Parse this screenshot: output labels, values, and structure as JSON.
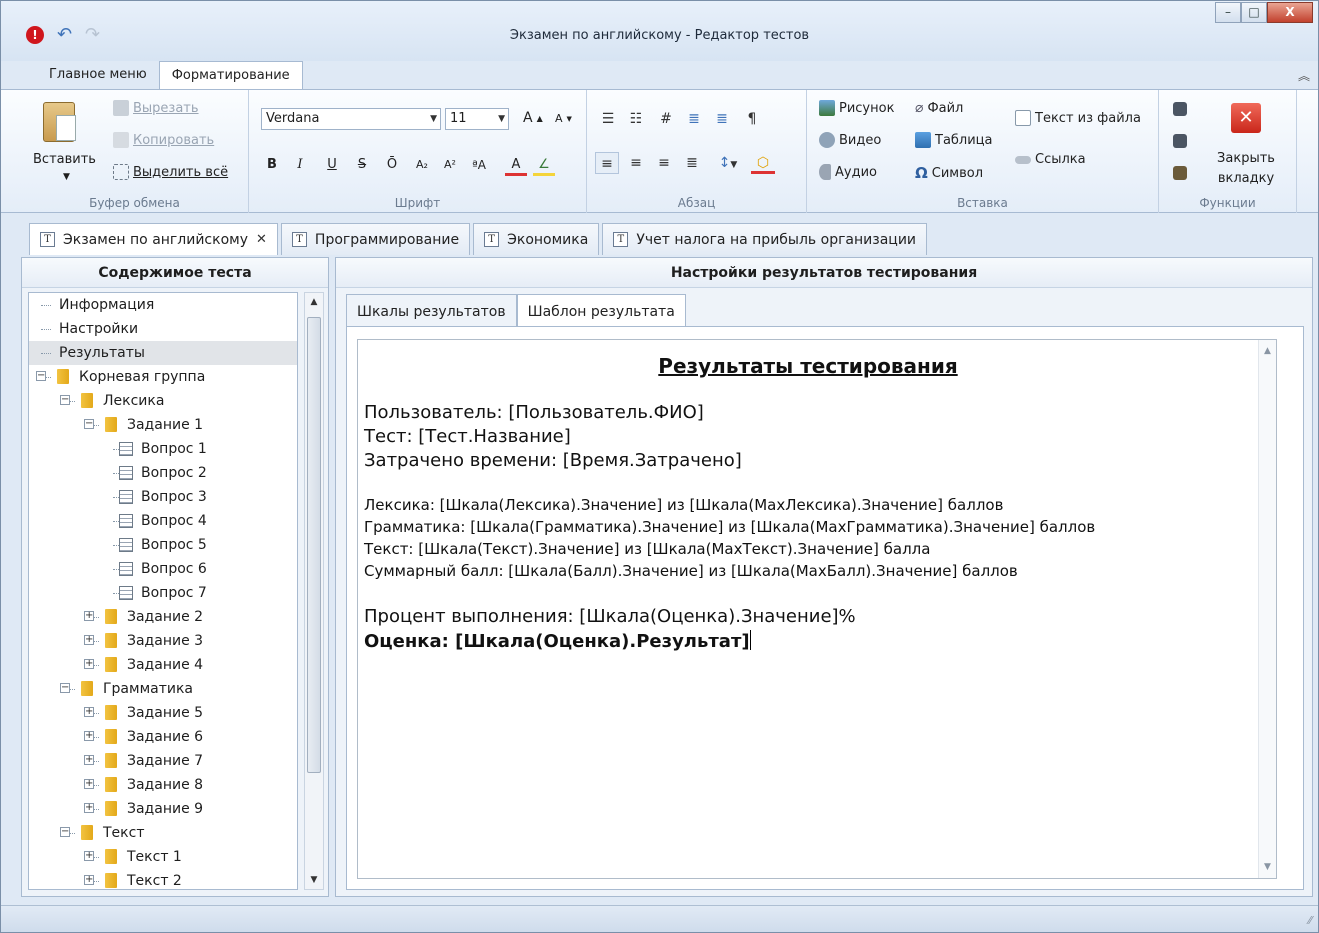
{
  "window": {
    "title": "Экзамен по английскому - Редактор тестов",
    "buttons": {
      "minimize": "–",
      "maximize": "□",
      "close": "X"
    }
  },
  "quick_access": {
    "info": "!",
    "undo": "↶",
    "redo": "↷"
  },
  "ribbon": {
    "tabs": [
      "Главное меню",
      "Форматирование"
    ],
    "active_tab": "Форматирование",
    "clipboard": {
      "label": "Буфер обмена",
      "paste": "Вставить",
      "cut": "Вырезать",
      "copy": "Копировать",
      "select_all": "Выделить всё"
    },
    "font": {
      "label": "Шрифт",
      "family": "Verdana",
      "size": "11",
      "buttons": [
        "B",
        "I",
        "U",
        "S",
        "Ō",
        "A₂",
        "A²",
        "ªA",
        "A",
        "∠"
      ],
      "grow": "A",
      "shrink": "A"
    },
    "paragraph": {
      "label": "Абзац",
      "row1": [
        "☰",
        "☷",
        "#",
        "≣",
        "≣",
        "¶"
      ],
      "row2": [
        "≡",
        "≡",
        "≡",
        "≣",
        "↕",
        "⬡"
      ]
    },
    "insert": {
      "label": "Вставка",
      "picture": "Рисунок",
      "video": "Видео",
      "audio": "Аудио",
      "file": "Файл",
      "table": "Таблица",
      "symbol": "Символ",
      "text_from_file": "Текст из файла",
      "link": "Ссылка"
    },
    "functions": {
      "label": "Функции",
      "close_tab": "Закрыть вкладку",
      "close_tab_line1": "Закрыть",
      "close_tab_line2": "вкладку"
    }
  },
  "doc_tabs": [
    {
      "label": "Экзамен по английскому",
      "active": true,
      "close": "✕"
    },
    {
      "label": "Программирование"
    },
    {
      "label": "Экономика"
    },
    {
      "label": "Учет налога на прибыль организации"
    }
  ],
  "left_panel": {
    "title": "Содержимое теста",
    "tree": [
      {
        "label": "Информация",
        "level": 0,
        "type": "leaf"
      },
      {
        "label": "Настройки",
        "level": 0,
        "type": "leaf"
      },
      {
        "label": "Результаты",
        "level": 0,
        "type": "leaf",
        "selected": true
      },
      {
        "label": "Корневая группа",
        "level": 0,
        "type": "folder",
        "expanded": true
      },
      {
        "label": "Лексика",
        "level": 1,
        "type": "folder",
        "expanded": true
      },
      {
        "label": "Задание 1",
        "level": 2,
        "type": "folder",
        "expanded": true
      },
      {
        "label": "Вопрос 1",
        "level": 3,
        "type": "question"
      },
      {
        "label": "Вопрос 2",
        "level": 3,
        "type": "question"
      },
      {
        "label": "Вопрос 3",
        "level": 3,
        "type": "question"
      },
      {
        "label": "Вопрос 4",
        "level": 3,
        "type": "question"
      },
      {
        "label": "Вопрос 5",
        "level": 3,
        "type": "question"
      },
      {
        "label": "Вопрос 6",
        "level": 3,
        "type": "question"
      },
      {
        "label": "Вопрос 7",
        "level": 3,
        "type": "question"
      },
      {
        "label": "Задание 2",
        "level": 2,
        "type": "folder",
        "expanded": false
      },
      {
        "label": "Задание 3",
        "level": 2,
        "type": "folder",
        "expanded": false
      },
      {
        "label": "Задание 4",
        "level": 2,
        "type": "folder",
        "expanded": false
      },
      {
        "label": "Грамматика",
        "level": 1,
        "type": "folder",
        "expanded": true
      },
      {
        "label": "Задание 5",
        "level": 2,
        "type": "folder",
        "expanded": false
      },
      {
        "label": "Задание 6",
        "level": 2,
        "type": "folder",
        "expanded": false
      },
      {
        "label": "Задание 7",
        "level": 2,
        "type": "folder",
        "expanded": false
      },
      {
        "label": "Задание 8",
        "level": 2,
        "type": "folder",
        "expanded": false
      },
      {
        "label": "Задание 9",
        "level": 2,
        "type": "folder",
        "expanded": false
      },
      {
        "label": "Текст",
        "level": 1,
        "type": "folder",
        "expanded": true
      },
      {
        "label": "Текст 1",
        "level": 2,
        "type": "folder",
        "expanded": false
      },
      {
        "label": "Текст 2",
        "level": 2,
        "type": "folder",
        "expanded": false
      }
    ]
  },
  "right_panel": {
    "title": "Настройки результатов тестирования",
    "tabs": [
      "Шкалы результатов",
      "Шаблон результата"
    ],
    "active_tab": "Шаблон результата",
    "editor": {
      "heading": "Результаты тестирования",
      "user": "Пользователь: [Пользователь.ФИО]",
      "test": "Тест: [Тест.Название]",
      "time": "Затрачено времени: [Время.Затрачено]",
      "lexis": "Лексика: [Шкала(Лексика).Значение] из [Шкала(МахЛексика).Значение] баллов",
      "grammar": "Грамматика: [Шкала(Грамматика).Значение] из [Шкала(МахГрамматика).Значение] баллов",
      "text": "Текст: [Шкала(Текст).Значение] из [Шкала(МахТекст).Значение] балла",
      "total": "Суммарный балл: [Шкала(Балл).Значение] из [Шкала(МахБалл).Значение] баллов",
      "percent": "Процент выполнения: [Шкала(Оценка).Значение]%",
      "grade": "Оценка: [Шкала(Оценка).Результат]"
    }
  },
  "colors": {
    "accent": "#3f73b9",
    "close_red": "#c9261a",
    "folder": "#e9b52a"
  }
}
